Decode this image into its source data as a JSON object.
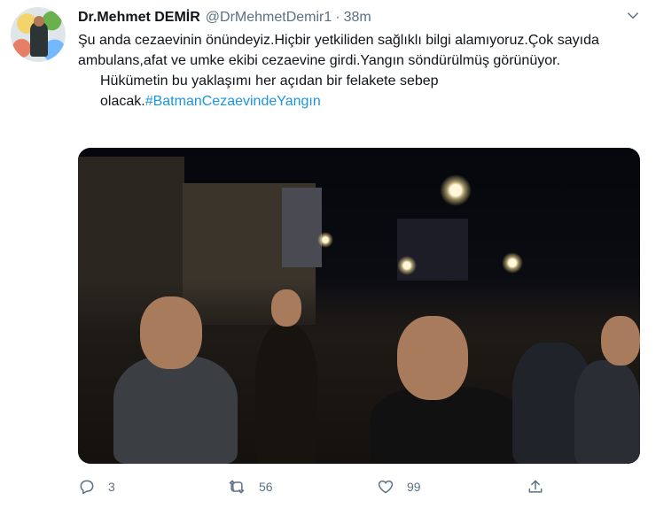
{
  "tweet": {
    "author_name": "Dr.Mehmet DEMİR",
    "handle": "@DrMehmetDemir1",
    "separator": "·",
    "time": "38m",
    "text_line1": "Şu anda cezaevinin önündeyiz.Hiçbir yetkiliden sağlıklı bilgi alamıyoruz.Çok sayıda ambulans,afat ve umke ekibi cezaevine girdi.Yangın söndürülmüş görünüyor.",
    "text_line2": "Hükümetin bu yaklaşımı her açıdan bir felakete sebep olacak.",
    "hashtag": "#BatmanCezaevindeYangın"
  },
  "actions": {
    "reply_count": "3",
    "retweet_count": "56",
    "like_count": "99"
  },
  "icons": {
    "reply": "reply-icon",
    "retweet": "retweet-icon",
    "like": "heart-icon",
    "share": "share-icon",
    "more": "chevron-down-icon"
  },
  "colors": {
    "text": "#0f1419",
    "muted": "#5b7083",
    "link": "#1b95e0"
  }
}
